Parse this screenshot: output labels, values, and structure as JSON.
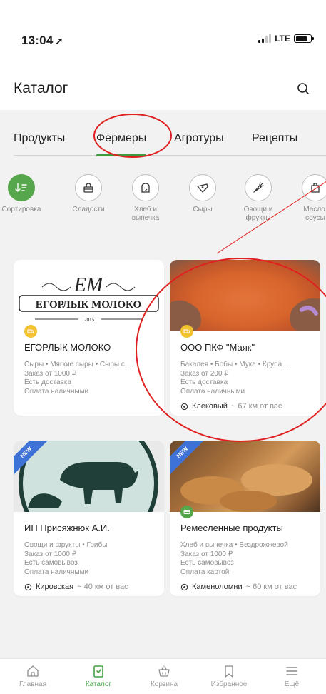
{
  "status_bar": {
    "time": "13:04",
    "location_glyph": "➚",
    "network": "LTE",
    "battery_percent": 78
  },
  "header": {
    "title": "Каталог",
    "search_icon": "search-icon"
  },
  "tabs": [
    {
      "label": "Продукты",
      "active": false
    },
    {
      "label": "Фермеры",
      "active": true
    },
    {
      "label": "Агротуры",
      "active": false
    },
    {
      "label": "Рецепты",
      "active": false
    }
  ],
  "categories": [
    {
      "label": "Сортировка",
      "icon": "sort-icon",
      "highlight": true
    },
    {
      "label": "Сладости",
      "icon": "cake-icon"
    },
    {
      "label": "Хлеб и выпечка",
      "icon": "bread-icon"
    },
    {
      "label": "Сыры",
      "icon": "cheese-icon"
    },
    {
      "label": "Овощи и фрукты",
      "icon": "carrot-icon"
    },
    {
      "label": "Масло, соусы",
      "icon": "oil-icon"
    }
  ],
  "farmers": [
    {
      "name": "ЕГОРЛЫК МОЛОКО",
      "logo_monogram": "ЕМ",
      "logo_text": "ЕГОРЛЫК МОЛОКО",
      "logo_year": "2015",
      "tags": "Сыры • Мягкие сыры • Сыры с …",
      "min_order": "Заказ от 1000 ₽",
      "delivery": "Есть доставка",
      "payment": "Оплата наличными",
      "location": "",
      "distance": "",
      "badge_color": "#f2c230",
      "is_new": false
    },
    {
      "name": "ООО ПКФ \"Маяк\"",
      "tags": "Бакалея • Бобы • Мука • Крупа …",
      "min_order": "Заказ от 200 ₽",
      "delivery": "Есть доставка",
      "payment": "Оплата наличными",
      "location": "Клековый",
      "distance": "~ 67 км от вас",
      "badge_color": "#f2c230",
      "is_new": false
    },
    {
      "name": "ИП Присяжнюк А.И.",
      "tags": "Овощи и фрукты • Грибы",
      "min_order": "Заказ от 1000 ₽",
      "delivery": "Есть самовывоз",
      "payment": "Оплата наличными",
      "location": "Кировская",
      "distance": "~ 40 км от вас",
      "badge_color": "#56a64b",
      "is_new": true,
      "new_label": "NEW"
    },
    {
      "name": "Ремесленные продукты",
      "tags": "Хлеб и выпечка • Бездрожжевой",
      "min_order": "Заказ от 1000 ₽",
      "delivery": "Есть самовывоз",
      "payment": "Оплата картой",
      "location": "Каменоломни",
      "distance": "~ 60 км от вас",
      "badge_color": "#56a64b",
      "is_new": true,
      "new_label": "NEW"
    }
  ],
  "bottom_nav": [
    {
      "label": "Главная",
      "icon": "home-icon",
      "active": false
    },
    {
      "label": "Каталог",
      "icon": "catalog-icon",
      "active": true
    },
    {
      "label": "Корзина",
      "icon": "basket-icon",
      "active": false
    },
    {
      "label": "Избранное",
      "icon": "bookmark-icon",
      "active": false
    },
    {
      "label": "Ещё",
      "icon": "menu-icon",
      "active": false
    }
  ],
  "colors": {
    "accent_green": "#45a046",
    "annotation_red": "#e02020",
    "new_badge_blue": "#3f72d6"
  }
}
